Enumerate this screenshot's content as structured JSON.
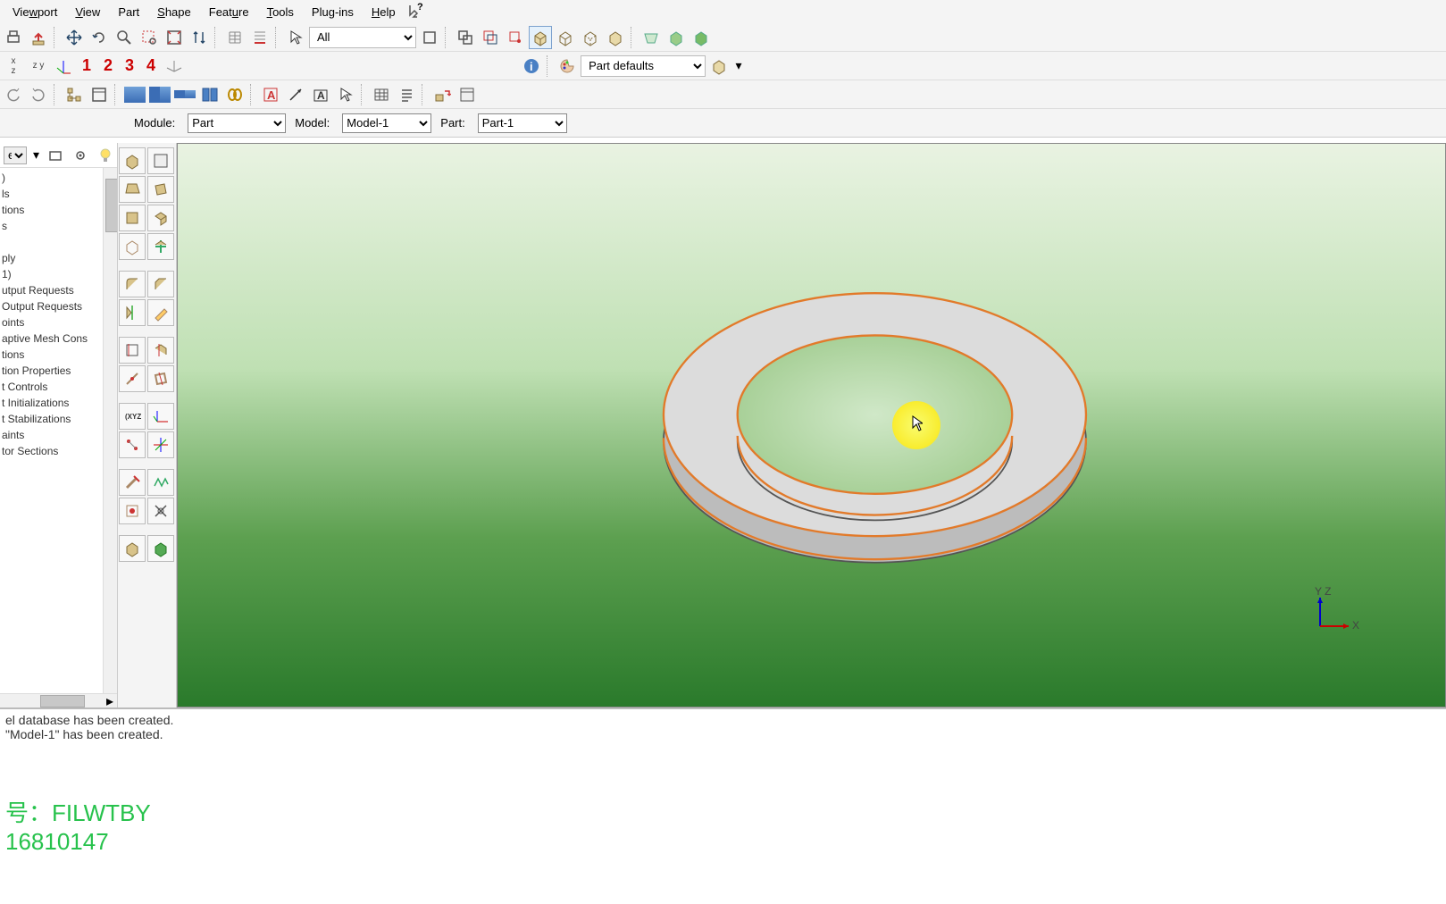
{
  "menu": {
    "viewport": "Viewport",
    "view": "View",
    "part": "Part",
    "shape": "Shape",
    "feature": "Feature",
    "tools": "Tools",
    "plugins": "Plug-ins",
    "help": "Help"
  },
  "toolbar": {
    "select_filter": "All",
    "color_scheme": "Part defaults",
    "annotate": {
      "n1": "1",
      "n2": "2",
      "n3": "3",
      "n4": "4"
    }
  },
  "context": {
    "module_label": "Module:",
    "module_value": "Part",
    "model_label": "Model:",
    "model_value": "Model-1",
    "part_label": "Part:",
    "part_value": "Part-1"
  },
  "tree": {
    "items": [
      ")",
      "ls",
      "tions",
      "s",
      "ply",
      "1)",
      "utput Requests",
      " Output Requests",
      "oints",
      "aptive Mesh Cons",
      "tions",
      "tion Properties",
      "t Controls",
      "t Initializations",
      "t Stabilizations",
      "aints",
      "tor Sections"
    ]
  },
  "triad": {
    "x": "X",
    "yz": "Y Z"
  },
  "messages": {
    "line1": "el database has been created.",
    "line2": " \"Model-1\" has been created."
  },
  "watermark": {
    "l1": "号：FILWTBY",
    "l2": "16810147"
  }
}
